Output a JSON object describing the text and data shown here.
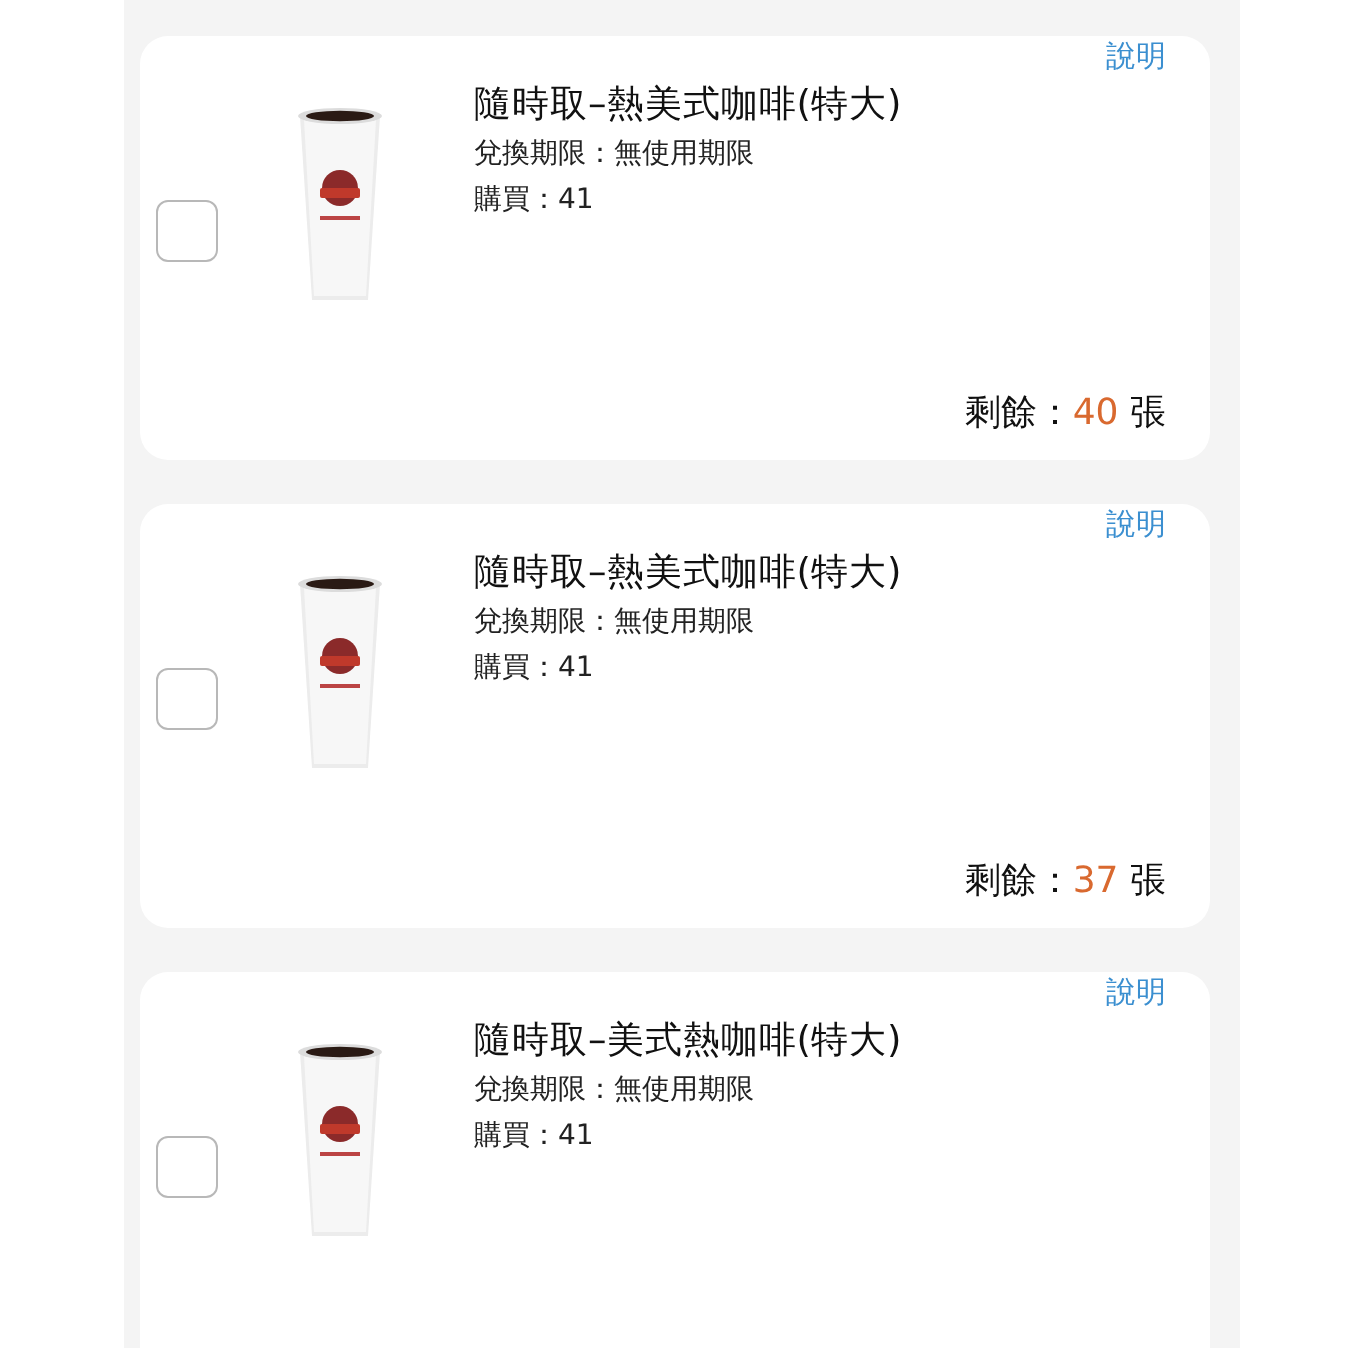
{
  "vouchers": [
    {
      "help_link": "說明",
      "title": "隨時取–熱美式咖啡(特大)",
      "expiry": "兌換期限：無使用期限",
      "purchased": "購買：41",
      "checked": false,
      "remaining_label": "剩餘：",
      "remaining_count": "40",
      "remaining_unit": "張"
    },
    {
      "help_link": "說明",
      "title": "隨時取–熱美式咖啡(特大)",
      "expiry": "兌換期限：無使用期限",
      "purchased": "購買：41",
      "checked": false,
      "remaining_label": "剩餘：",
      "remaining_count": "37",
      "remaining_unit": "張"
    },
    {
      "help_link": "說明",
      "title": "隨時取–美式熱咖啡(特大)",
      "expiry": "兌換期限：無使用期限",
      "purchased": "購買：41",
      "checked": false
    }
  ]
}
